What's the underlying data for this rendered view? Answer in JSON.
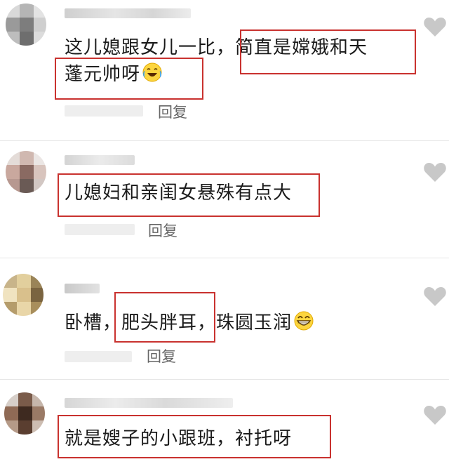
{
  "comments": [
    {
      "lines": [
        "这儿媳跟女儿一比，简直是嫦娥和天",
        "蓬元帅呀"
      ],
      "emoji": "crying-laughing-emoji",
      "reply_label": "回复"
    },
    {
      "lines": [
        "儿媳妇和亲闺女悬殊有点大"
      ],
      "reply_label": "回复"
    },
    {
      "lines": [
        "卧槽，肥头胖耳，珠圆玉润"
      ],
      "emoji": "grinning-emoji",
      "reply_label": "回复"
    },
    {
      "lines": [
        "就是嫂子的小跟班，衬托呀"
      ],
      "reply_label": "回复"
    }
  ],
  "colors": {
    "highlight_box": "#c9322f",
    "heart": "#c8c8c8",
    "reply_text": "#666666"
  }
}
